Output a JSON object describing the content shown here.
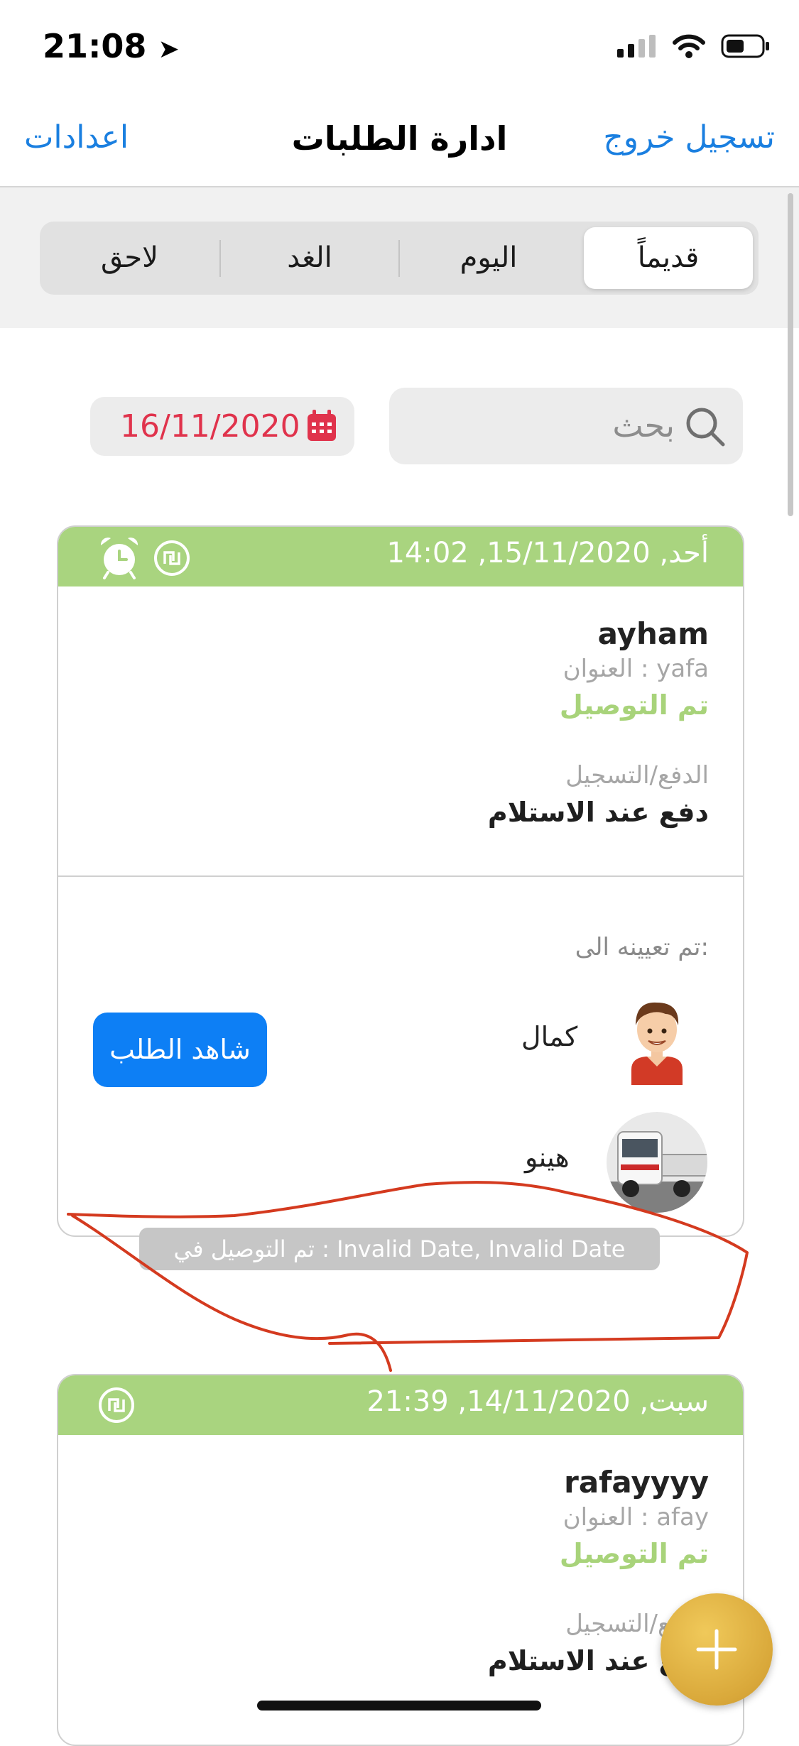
{
  "status_bar": {
    "time": "21:08"
  },
  "nav": {
    "left": "اعدادات",
    "title": "ادارة الطلبات",
    "right": "تسجيل خروج"
  },
  "segments": {
    "later": "لاحق",
    "tomorrow": "الغد",
    "today": "اليوم",
    "old": "قديماً"
  },
  "search": {
    "placeholder": "بحث"
  },
  "date_filter": {
    "value": "16/11/2020"
  },
  "orders": [
    {
      "header": "أحد, 15/11/2020, 14:02",
      "name": "ayham",
      "address": "العنوان : yafa",
      "status": "تم التوصيل",
      "payment_label": "الدفع/التسجيل",
      "payment_value": "دفع عند الاستلام",
      "assigned_label": "تم تعيينه الى:",
      "driver": "كمال",
      "vehicle": "هينو",
      "view_button": "شاهد الطلب",
      "delivered_note": "تم التوصيل في : Invalid Date, Invalid Date"
    },
    {
      "header": "سبت, 14/11/2020, 21:39",
      "name": "rafayyyy",
      "address": "العنوان : afay",
      "status": "تم التوصيل",
      "payment_label": "الدفع/التسجيل",
      "payment_value": "دفع عند الاستلام"
    }
  ],
  "colors": {
    "accent": "#1a7fe0",
    "header_green": "#a9d47f",
    "date_red": "#e0334c",
    "button_blue": "#0d7ff5",
    "annotation_red": "#d43a1f"
  }
}
